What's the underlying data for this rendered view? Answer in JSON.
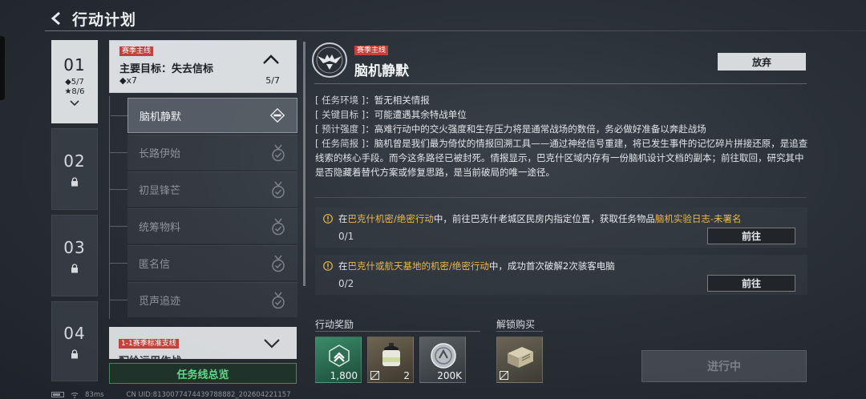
{
  "header": {
    "title": "行动计划"
  },
  "chapters": [
    {
      "num": "01",
      "stat1": "◆5/7",
      "stat2": "★8/6"
    },
    {
      "num": "02"
    },
    {
      "num": "03"
    },
    {
      "num": "04"
    }
  ],
  "main_mission": {
    "tag": "赛季主线",
    "goal": "主要目标：失去信标",
    "reward": "◆x7",
    "progress": "5/7"
  },
  "steps": [
    "脑机静默",
    "长路伊始",
    "初显锋芒",
    "统筹物料",
    "匿名信",
    "觅声追迹"
  ],
  "branch": {
    "tag": "1-1赛季标准支线",
    "subtitle": "配给运用作战"
  },
  "overview_button": "任务线总览",
  "detail": {
    "tag": "赛季主线",
    "title": "脑机静默",
    "abandon": "放弃",
    "env_key": "[ 任务环境 ]",
    "env_val": "暂无相关情报",
    "target_key": "[ 关键目标 ]",
    "target_val": "可能遭遇其余特战单位",
    "intensity_key": "[ 预计强度 ]",
    "intensity_val": "高难行动中的交火强度和生存压力将是通常战场的数倍，务必做好准备以奔赴战场",
    "brief_key": "[ 任务简报 ]",
    "brief_val": "脑机曾是我们最为倚仗的情报回溯工具——通过神经信号重建，将已发生事件的记忆碎片拼接还原，是追查线索的核心手段。而今这条路径已被封死。情报显示，巴克什区域内存有一份脑机设计文档的副本；前往取回，研究其中是否隐藏着替代方案或修复思路，是当前破局的唯一途径。"
  },
  "tasks": [
    {
      "prefix": "在",
      "hl1": "巴克什机密/绝密行动",
      "mid": "中，前往巴克什老城区民房内指定位置，获取任务物品",
      "hl2": "脑机实验日志-未署名",
      "count": "0/1",
      "button": "前往"
    },
    {
      "prefix": "在",
      "hl1": "巴克什或航天基地的机密/绝密行动",
      "mid": "中，成功首次破解2次骇客电脑",
      "hl2": "",
      "count": "0/2",
      "button": "前往"
    }
  ],
  "rewards": {
    "label": "行动奖励",
    "items": [
      {
        "icon": "green-badge-icon",
        "qty": "1,800"
      },
      {
        "icon": "grenade-icon",
        "qty": "2"
      },
      {
        "icon": "coin-icon",
        "qty": "200K"
      }
    ]
  },
  "unlock": {
    "label": "解锁购买",
    "items": [
      {
        "icon": "device-box-icon"
      }
    ]
  },
  "progress_button": "进行中",
  "status": {
    "ping": "83ms",
    "uid": "CN UID:8130077474439788882_202604221157"
  },
  "colors": {
    "accent_green": "#5fd88a",
    "tag_red": "#c4423a",
    "highlight": "#e9b84a"
  }
}
